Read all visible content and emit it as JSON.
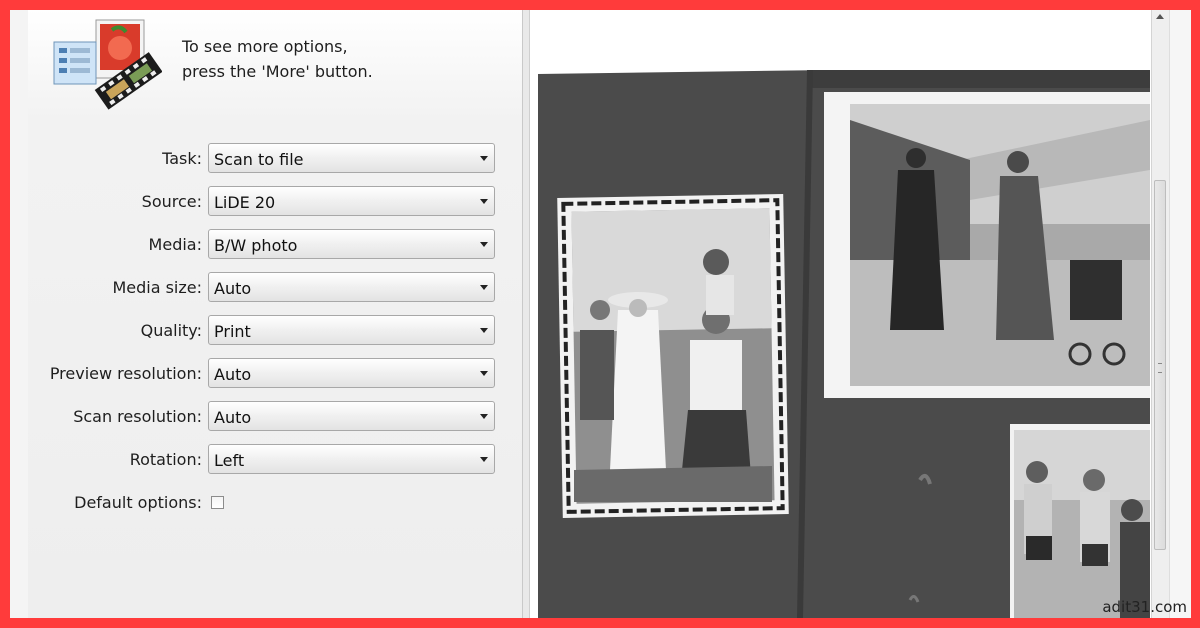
{
  "header": {
    "hint_line1": "To see more options,",
    "hint_line2": "press the 'More' button.",
    "icon": "scanner-photo-film-icon"
  },
  "options": [
    {
      "label": "Task:",
      "value": "Scan to file"
    },
    {
      "label": "Source:",
      "value": "LiDE 20"
    },
    {
      "label": "Media:",
      "value": "B/W photo"
    },
    {
      "label": "Media size:",
      "value": "Auto"
    },
    {
      "label": "Quality:",
      "value": "Print"
    },
    {
      "label": "Preview resolution:",
      "value": "Auto"
    },
    {
      "label": "Scan resolution:",
      "value": "Auto"
    },
    {
      "label": "Rotation:",
      "value": "Left"
    }
  ],
  "default_options": {
    "label": "Default options:",
    "checked": false
  },
  "preview": {
    "description_icon": "scanned-photo-preview"
  },
  "watermark": "adit31.com",
  "colors": {
    "border": "#ff3b3b",
    "scan_background": "#4a4a4a"
  }
}
